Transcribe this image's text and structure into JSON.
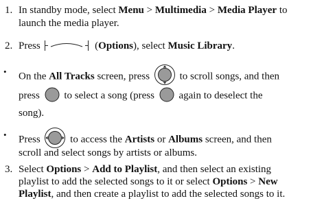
{
  "steps": [
    {
      "number": "1.",
      "line1_pre": "In standby mode, select ",
      "menu": "Menu",
      "sep1": " > ",
      "multimedia": "Multimedia",
      "sep2": " > ",
      "media_player": "Media Player",
      "line1_post": " to",
      "line2": "launch the media player."
    },
    {
      "number": "2.",
      "pre": "Press",
      "options": "Options",
      "mid": ", select ",
      "music_library": "Music Library",
      "post": "."
    },
    {
      "number": "3.",
      "pre": "Select ",
      "options": "Options",
      "sep": " > ",
      "add_to_playlist": "Add to Playlist",
      "line1_post": ", and then select an existing",
      "line2_pre": "playlist to add the selected songs to it or select ",
      "options2": "Options",
      "sep2": " > ",
      "new": "New",
      "playlist": "Playlist",
      "line3_post": ", and then create a playlist to add the selected songs to it."
    }
  ],
  "bullets": [
    {
      "symbol": "•",
      "line1_pre": "On the ",
      "all_tracks": "All Tracks",
      "line1_mid": " screen, press ",
      "line1_post": " to scroll songs, and then",
      "line2_pre": "press ",
      "line2_mid": " to select a song (press ",
      "line2_post": " again to deselect the",
      "line3": "song)."
    },
    {
      "symbol": "•",
      "pre": "Press ",
      "mid": " to access the ",
      "artists": "Artists",
      "or": " or ",
      "albums": "Albums",
      "post": " screen, and then",
      "line2": "scroll and select songs by artists or albums."
    }
  ],
  "icons": {
    "options_key": "left-softkey-icon",
    "nav_updown": "navigation-key-up-down-icon",
    "center_key": "center-select-key-icon",
    "nav_leftright": "navigation-key-left-right-icon"
  },
  "colors": {
    "key_fill": "#9a9a9a",
    "text": "#111111"
  }
}
